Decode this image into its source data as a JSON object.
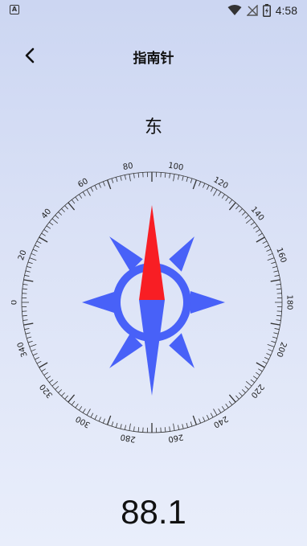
{
  "status_bar": {
    "app_icon_glyph": "A",
    "icons": [
      "wifi-icon",
      "signal-off-icon",
      "battery-charging-icon"
    ],
    "time": "4:58"
  },
  "header": {
    "title": "指南针",
    "back_icon": "chevron-left-icon"
  },
  "compass": {
    "direction": "东",
    "heading": "88.1",
    "degree_labels": [
      "0",
      "20",
      "40",
      "60",
      "80",
      "100",
      "120",
      "140",
      "160",
      "180",
      "200",
      "220",
      "240",
      "260",
      "280",
      "300",
      "320",
      "340"
    ],
    "colors": {
      "rose": "#4861f8",
      "needle_north": "#f81e24",
      "ticks": "#333333",
      "background_top": "#ccd6f2",
      "background_bottom": "#e9eefb"
    }
  }
}
